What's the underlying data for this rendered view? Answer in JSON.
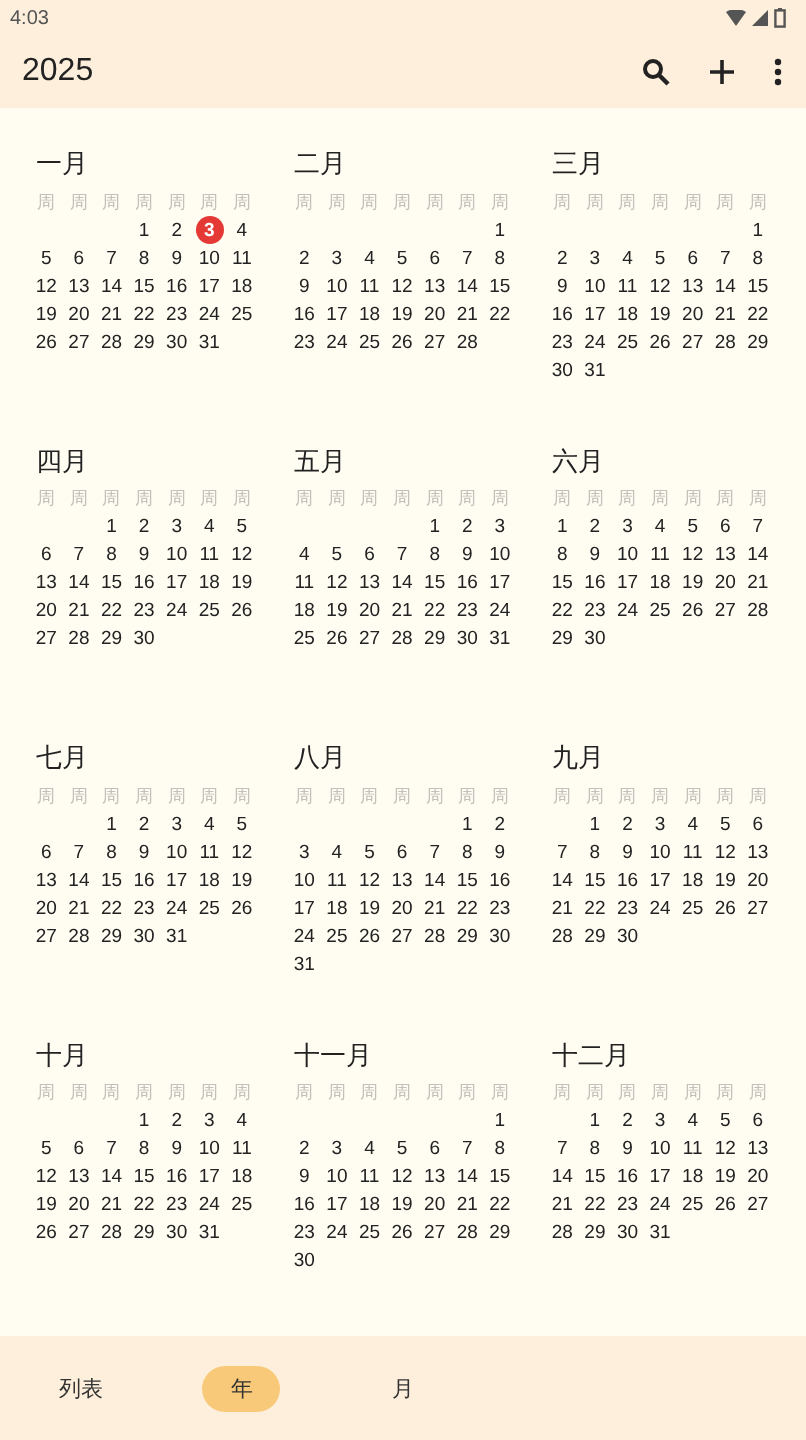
{
  "status_bar": {
    "time": "4:03"
  },
  "app_bar": {
    "title": "2025"
  },
  "months": [
    {
      "name": "一月",
      "weekdays": [
        "周",
        "周",
        "周",
        "周",
        "周",
        "周",
        "周"
      ],
      "weeks": [
        [
          {
            "day": "1",
            "selected": false
          },
          {
            "day": "2",
            "selected": false
          },
          {
            "day": "3",
            "selected": true
          },
          {
            "day": "4",
            "selected": false
          }
        ],
        [
          {
            "day": "5",
            "selected": false
          },
          {
            "day": "6",
            "selected": false
          },
          {
            "day": "7",
            "selected": false
          },
          {
            "day": "8",
            "selected": false
          },
          {
            "day": "9",
            "selected": false
          },
          {
            "day": "10",
            "selected": false
          },
          {
            "day": "11",
            "selected": false
          }
        ],
        [
          {
            "day": "12",
            "selected": false
          },
          {
            "day": "13",
            "selected": false
          },
          {
            "day": "14",
            "selected": false
          },
          {
            "day": "15",
            "selected": false
          },
          {
            "day": "16",
            "selected": false
          },
          {
            "day": "17",
            "selected": false
          },
          {
            "day": "18",
            "selected": false
          }
        ],
        [
          {
            "day": "19",
            "selected": false
          },
          {
            "day": "20",
            "selected": false
          },
          {
            "day": "21",
            "selected": false
          },
          {
            "day": "22",
            "selected": false
          },
          {
            "day": "23",
            "selected": false
          },
          {
            "day": "24",
            "selected": false
          },
          {
            "day": "25",
            "selected": false
          }
        ],
        [
          {
            "day": "26",
            "selected": false
          },
          {
            "day": "27",
            "selected": false
          },
          {
            "day": "28",
            "selected": false
          },
          {
            "day": "29",
            "selected": false
          },
          {
            "day": "30",
            "selected": false
          },
          {
            "day": "31",
            "selected": false
          }
        ]
      ]
    },
    {
      "name": "二月",
      "weekdays": [
        "周",
        "周",
        "周",
        "周",
        "周",
        "周",
        "周"
      ],
      "weeks": [
        [
          {
            "day": "1",
            "selected": false
          }
        ],
        [
          {
            "day": "2",
            "selected": false
          },
          {
            "day": "3",
            "selected": false
          },
          {
            "day": "4",
            "selected": false
          },
          {
            "day": "5",
            "selected": false
          },
          {
            "day": "6",
            "selected": false
          },
          {
            "day": "7",
            "selected": false
          },
          {
            "day": "8",
            "selected": false
          }
        ],
        [
          {
            "day": "9",
            "selected": false
          },
          {
            "day": "10",
            "selected": false
          },
          {
            "day": "11",
            "selected": false
          },
          {
            "day": "12",
            "selected": false
          },
          {
            "day": "13",
            "selected": false
          },
          {
            "day": "14",
            "selected": false
          },
          {
            "day": "15",
            "selected": false
          }
        ],
        [
          {
            "day": "16",
            "selected": false
          },
          {
            "day": "17",
            "selected": false
          },
          {
            "day": "18",
            "selected": false
          },
          {
            "day": "19",
            "selected": false
          },
          {
            "day": "20",
            "selected": false
          },
          {
            "day": "21",
            "selected": false
          },
          {
            "day": "22",
            "selected": false
          }
        ],
        [
          {
            "day": "23",
            "selected": false
          },
          {
            "day": "24",
            "selected": false
          },
          {
            "day": "25",
            "selected": false
          },
          {
            "day": "26",
            "selected": false
          },
          {
            "day": "27",
            "selected": false
          },
          {
            "day": "28",
            "selected": false
          }
        ]
      ]
    },
    {
      "name": "三月",
      "weekdays": [
        "周",
        "周",
        "周",
        "周",
        "周",
        "周",
        "周"
      ],
      "weeks": [
        [
          {
            "day": "1",
            "selected": false
          }
        ],
        [
          {
            "day": "2",
            "selected": false
          },
          {
            "day": "3",
            "selected": false
          },
          {
            "day": "4",
            "selected": false
          },
          {
            "day": "5",
            "selected": false
          },
          {
            "day": "6",
            "selected": false
          },
          {
            "day": "7",
            "selected": false
          },
          {
            "day": "8",
            "selected": false
          }
        ],
        [
          {
            "day": "9",
            "selected": false
          },
          {
            "day": "10",
            "selected": false
          },
          {
            "day": "11",
            "selected": false
          },
          {
            "day": "12",
            "selected": false
          },
          {
            "day": "13",
            "selected": false
          },
          {
            "day": "14",
            "selected": false
          },
          {
            "day": "15",
            "selected": false
          }
        ],
        [
          {
            "day": "16",
            "selected": false
          },
          {
            "day": "17",
            "selected": false
          },
          {
            "day": "18",
            "selected": false
          },
          {
            "day": "19",
            "selected": false
          },
          {
            "day": "20",
            "selected": false
          },
          {
            "day": "21",
            "selected": false
          },
          {
            "day": "22",
            "selected": false
          }
        ],
        [
          {
            "day": "23",
            "selected": false
          },
          {
            "day": "24",
            "selected": false
          },
          {
            "day": "25",
            "selected": false
          },
          {
            "day": "26",
            "selected": false
          },
          {
            "day": "27",
            "selected": false
          },
          {
            "day": "28",
            "selected": false
          },
          {
            "day": "29",
            "selected": false
          }
        ],
        [
          {
            "day": "30",
            "selected": false
          },
          {
            "day": "31",
            "selected": false
          }
        ]
      ]
    },
    {
      "name": "四月",
      "weekdays": [
        "周",
        "周",
        "周",
        "周",
        "周",
        "周",
        "周"
      ],
      "weeks": [
        [
          {
            "day": "1",
            "selected": false
          },
          {
            "day": "2",
            "selected": false
          },
          {
            "day": "3",
            "selected": false
          },
          {
            "day": "4",
            "selected": false
          },
          {
            "day": "5",
            "selected": false
          }
        ],
        [
          {
            "day": "6",
            "selected": false
          },
          {
            "day": "7",
            "selected": false
          },
          {
            "day": "8",
            "selected": false
          },
          {
            "day": "9",
            "selected": false
          },
          {
            "day": "10",
            "selected": false
          },
          {
            "day": "11",
            "selected": false
          },
          {
            "day": "12",
            "selected": false
          }
        ],
        [
          {
            "day": "13",
            "selected": false
          },
          {
            "day": "14",
            "selected": false
          },
          {
            "day": "15",
            "selected": false
          },
          {
            "day": "16",
            "selected": false
          },
          {
            "day": "17",
            "selected": false
          },
          {
            "day": "18",
            "selected": false
          },
          {
            "day": "19",
            "selected": false
          }
        ],
        [
          {
            "day": "20",
            "selected": false
          },
          {
            "day": "21",
            "selected": false
          },
          {
            "day": "22",
            "selected": false
          },
          {
            "day": "23",
            "selected": false
          },
          {
            "day": "24",
            "selected": false
          },
          {
            "day": "25",
            "selected": false
          },
          {
            "day": "26",
            "selected": false
          }
        ],
        [
          {
            "day": "27",
            "selected": false
          },
          {
            "day": "28",
            "selected": false
          },
          {
            "day": "29",
            "selected": false
          },
          {
            "day": "30",
            "selected": false
          }
        ]
      ]
    },
    {
      "name": "五月",
      "weekdays": [
        "周",
        "周",
        "周",
        "周",
        "周",
        "周",
        "周"
      ],
      "weeks": [
        [
          {
            "day": "1",
            "selected": false
          },
          {
            "day": "2",
            "selected": false
          },
          {
            "day": "3",
            "selected": false
          }
        ],
        [
          {
            "day": "4",
            "selected": false
          },
          {
            "day": "5",
            "selected": false
          },
          {
            "day": "6",
            "selected": false
          },
          {
            "day": "7",
            "selected": false
          },
          {
            "day": "8",
            "selected": false
          },
          {
            "day": "9",
            "selected": false
          },
          {
            "day": "10",
            "selected": false
          }
        ],
        [
          {
            "day": "11",
            "selected": false
          },
          {
            "day": "12",
            "selected": false
          },
          {
            "day": "13",
            "selected": false
          },
          {
            "day": "14",
            "selected": false
          },
          {
            "day": "15",
            "selected": false
          },
          {
            "day": "16",
            "selected": false
          },
          {
            "day": "17",
            "selected": false
          }
        ],
        [
          {
            "day": "18",
            "selected": false
          },
          {
            "day": "19",
            "selected": false
          },
          {
            "day": "20",
            "selected": false
          },
          {
            "day": "21",
            "selected": false
          },
          {
            "day": "22",
            "selected": false
          },
          {
            "day": "23",
            "selected": false
          },
          {
            "day": "24",
            "selected": false
          }
        ],
        [
          {
            "day": "25",
            "selected": false
          },
          {
            "day": "26",
            "selected": false
          },
          {
            "day": "27",
            "selected": false
          },
          {
            "day": "28",
            "selected": false
          },
          {
            "day": "29",
            "selected": false
          },
          {
            "day": "30",
            "selected": false
          },
          {
            "day": "31",
            "selected": false
          }
        ]
      ]
    },
    {
      "name": "六月",
      "weekdays": [
        "周",
        "周",
        "周",
        "周",
        "周",
        "周",
        "周"
      ],
      "weeks": [
        [
          {
            "day": "1",
            "selected": false
          },
          {
            "day": "2",
            "selected": false
          },
          {
            "day": "3",
            "selected": false
          },
          {
            "day": "4",
            "selected": false
          },
          {
            "day": "5",
            "selected": false
          },
          {
            "day": "6",
            "selected": false
          },
          {
            "day": "7",
            "selected": false
          }
        ],
        [
          {
            "day": "8",
            "selected": false
          },
          {
            "day": "9",
            "selected": false
          },
          {
            "day": "10",
            "selected": false
          },
          {
            "day": "11",
            "selected": false
          },
          {
            "day": "12",
            "selected": false
          },
          {
            "day": "13",
            "selected": false
          },
          {
            "day": "14",
            "selected": false
          }
        ],
        [
          {
            "day": "15",
            "selected": false
          },
          {
            "day": "16",
            "selected": false
          },
          {
            "day": "17",
            "selected": false
          },
          {
            "day": "18",
            "selected": false
          },
          {
            "day": "19",
            "selected": false
          },
          {
            "day": "20",
            "selected": false
          },
          {
            "day": "21",
            "selected": false
          }
        ],
        [
          {
            "day": "22",
            "selected": false
          },
          {
            "day": "23",
            "selected": false
          },
          {
            "day": "24",
            "selected": false
          },
          {
            "day": "25",
            "selected": false
          },
          {
            "day": "26",
            "selected": false
          },
          {
            "day": "27",
            "selected": false
          },
          {
            "day": "28",
            "selected": false
          }
        ],
        [
          {
            "day": "29",
            "selected": false
          },
          {
            "day": "30",
            "selected": false
          }
        ]
      ]
    },
    {
      "name": "七月",
      "weekdays": [
        "周",
        "周",
        "周",
        "周",
        "周",
        "周",
        "周"
      ],
      "weeks": [
        [
          {
            "day": "1",
            "selected": false
          },
          {
            "day": "2",
            "selected": false
          },
          {
            "day": "3",
            "selected": false
          },
          {
            "day": "4",
            "selected": false
          },
          {
            "day": "5",
            "selected": false
          }
        ],
        [
          {
            "day": "6",
            "selected": false
          },
          {
            "day": "7",
            "selected": false
          },
          {
            "day": "8",
            "selected": false
          },
          {
            "day": "9",
            "selected": false
          },
          {
            "day": "10",
            "selected": false
          },
          {
            "day": "11",
            "selected": false
          },
          {
            "day": "12",
            "selected": false
          }
        ],
        [
          {
            "day": "13",
            "selected": false
          },
          {
            "day": "14",
            "selected": false
          },
          {
            "day": "15",
            "selected": false
          },
          {
            "day": "16",
            "selected": false
          },
          {
            "day": "17",
            "selected": false
          },
          {
            "day": "18",
            "selected": false
          },
          {
            "day": "19",
            "selected": false
          }
        ],
        [
          {
            "day": "20",
            "selected": false
          },
          {
            "day": "21",
            "selected": false
          },
          {
            "day": "22",
            "selected": false
          },
          {
            "day": "23",
            "selected": false
          },
          {
            "day": "24",
            "selected": false
          },
          {
            "day": "25",
            "selected": false
          },
          {
            "day": "26",
            "selected": false
          }
        ],
        [
          {
            "day": "27",
            "selected": false
          },
          {
            "day": "28",
            "selected": false
          },
          {
            "day": "29",
            "selected": false
          },
          {
            "day": "30",
            "selected": false
          },
          {
            "day": "31",
            "selected": false
          }
        ]
      ]
    },
    {
      "name": "八月",
      "weekdays": [
        "周",
        "周",
        "周",
        "周",
        "周",
        "周",
        "周"
      ],
      "weeks": [
        [
          {
            "day": "1",
            "selected": false
          },
          {
            "day": "2",
            "selected": false
          }
        ],
        [
          {
            "day": "3",
            "selected": false
          },
          {
            "day": "4",
            "selected": false
          },
          {
            "day": "5",
            "selected": false
          },
          {
            "day": "6",
            "selected": false
          },
          {
            "day": "7",
            "selected": false
          },
          {
            "day": "8",
            "selected": false
          },
          {
            "day": "9",
            "selected": false
          }
        ],
        [
          {
            "day": "10",
            "selected": false
          },
          {
            "day": "11",
            "selected": false
          },
          {
            "day": "12",
            "selected": false
          },
          {
            "day": "13",
            "selected": false
          },
          {
            "day": "14",
            "selected": false
          },
          {
            "day": "15",
            "selected": false
          },
          {
            "day": "16",
            "selected": false
          }
        ],
        [
          {
            "day": "17",
            "selected": false
          },
          {
            "day": "18",
            "selected": false
          },
          {
            "day": "19",
            "selected": false
          },
          {
            "day": "20",
            "selected": false
          },
          {
            "day": "21",
            "selected": false
          },
          {
            "day": "22",
            "selected": false
          },
          {
            "day": "23",
            "selected": false
          }
        ],
        [
          {
            "day": "24",
            "selected": false
          },
          {
            "day": "25",
            "selected": false
          },
          {
            "day": "26",
            "selected": false
          },
          {
            "day": "27",
            "selected": false
          },
          {
            "day": "28",
            "selected": false
          },
          {
            "day": "29",
            "selected": false
          },
          {
            "day": "30",
            "selected": false
          }
        ],
        [
          {
            "day": "31",
            "selected": false
          }
        ]
      ]
    },
    {
      "name": "九月",
      "weekdays": [
        "周",
        "周",
        "周",
        "周",
        "周",
        "周",
        "周"
      ],
      "weeks": [
        [
          {
            "day": "1",
            "selected": false
          },
          {
            "day": "2",
            "selected": false
          },
          {
            "day": "3",
            "selected": false
          },
          {
            "day": "4",
            "selected": false
          },
          {
            "day": "5",
            "selected": false
          },
          {
            "day": "6",
            "selected": false
          }
        ],
        [
          {
            "day": "7",
            "selected": false
          },
          {
            "day": "8",
            "selected": false
          },
          {
            "day": "9",
            "selected": false
          },
          {
            "day": "10",
            "selected": false
          },
          {
            "day": "11",
            "selected": false
          },
          {
            "day": "12",
            "selected": false
          },
          {
            "day": "13",
            "selected": false
          }
        ],
        [
          {
            "day": "14",
            "selected": false
          },
          {
            "day": "15",
            "selected": false
          },
          {
            "day": "16",
            "selected": false
          },
          {
            "day": "17",
            "selected": false
          },
          {
            "day": "18",
            "selected": false
          },
          {
            "day": "19",
            "selected": false
          },
          {
            "day": "20",
            "selected": false
          }
        ],
        [
          {
            "day": "21",
            "selected": false
          },
          {
            "day": "22",
            "selected": false
          },
          {
            "day": "23",
            "selected": false
          },
          {
            "day": "24",
            "selected": false
          },
          {
            "day": "25",
            "selected": false
          },
          {
            "day": "26",
            "selected": false
          },
          {
            "day": "27",
            "selected": false
          }
        ],
        [
          {
            "day": "28",
            "selected": false
          },
          {
            "day": "29",
            "selected": false
          },
          {
            "day": "30",
            "selected": false
          }
        ]
      ]
    },
    {
      "name": "十月",
      "weekdays": [
        "周",
        "周",
        "周",
        "周",
        "周",
        "周",
        "周"
      ],
      "weeks": [
        [
          {
            "day": "1",
            "selected": false
          },
          {
            "day": "2",
            "selected": false
          },
          {
            "day": "3",
            "selected": false
          },
          {
            "day": "4",
            "selected": false
          }
        ],
        [
          {
            "day": "5",
            "selected": false
          },
          {
            "day": "6",
            "selected": false
          },
          {
            "day": "7",
            "selected": false
          },
          {
            "day": "8",
            "selected": false
          },
          {
            "day": "9",
            "selected": false
          },
          {
            "day": "10",
            "selected": false
          },
          {
            "day": "11",
            "selected": false
          }
        ],
        [
          {
            "day": "12",
            "selected": false
          },
          {
            "day": "13",
            "selected": false
          },
          {
            "day": "14",
            "selected": false
          },
          {
            "day": "15",
            "selected": false
          },
          {
            "day": "16",
            "selected": false
          },
          {
            "day": "17",
            "selected": false
          },
          {
            "day": "18",
            "selected": false
          }
        ],
        [
          {
            "day": "19",
            "selected": false
          },
          {
            "day": "20",
            "selected": false
          },
          {
            "day": "21",
            "selected": false
          },
          {
            "day": "22",
            "selected": false
          },
          {
            "day": "23",
            "selected": false
          },
          {
            "day": "24",
            "selected": false
          },
          {
            "day": "25",
            "selected": false
          }
        ],
        [
          {
            "day": "26",
            "selected": false
          },
          {
            "day": "27",
            "selected": false
          },
          {
            "day": "28",
            "selected": false
          },
          {
            "day": "29",
            "selected": false
          },
          {
            "day": "30",
            "selected": false
          },
          {
            "day": "31",
            "selected": false
          }
        ]
      ]
    },
    {
      "name": "十一月",
      "weekdays": [
        "周",
        "周",
        "周",
        "周",
        "周",
        "周",
        "周"
      ],
      "weeks": [
        [
          {
            "day": "1",
            "selected": false
          }
        ],
        [
          {
            "day": "2",
            "selected": false
          },
          {
            "day": "3",
            "selected": false
          },
          {
            "day": "4",
            "selected": false
          },
          {
            "day": "5",
            "selected": false
          },
          {
            "day": "6",
            "selected": false
          },
          {
            "day": "7",
            "selected": false
          },
          {
            "day": "8",
            "selected": false
          }
        ],
        [
          {
            "day": "9",
            "selected": false
          },
          {
            "day": "10",
            "selected": false
          },
          {
            "day": "11",
            "selected": false
          },
          {
            "day": "12",
            "selected": false
          },
          {
            "day": "13",
            "selected": false
          },
          {
            "day": "14",
            "selected": false
          },
          {
            "day": "15",
            "selected": false
          }
        ],
        [
          {
            "day": "16",
            "selected": false
          },
          {
            "day": "17",
            "selected": false
          },
          {
            "day": "18",
            "selected": false
          },
          {
            "day": "19",
            "selected": false
          },
          {
            "day": "20",
            "selected": false
          },
          {
            "day": "21",
            "selected": false
          },
          {
            "day": "22",
            "selected": false
          }
        ],
        [
          {
            "day": "23",
            "selected": false
          },
          {
            "day": "24",
            "selected": false
          },
          {
            "day": "25",
            "selected": false
          },
          {
            "day": "26",
            "selected": false
          },
          {
            "day": "27",
            "selected": false
          },
          {
            "day": "28",
            "selected": false
          },
          {
            "day": "29",
            "selected": false
          }
        ],
        [
          {
            "day": "30",
            "selected": false
          }
        ]
      ]
    },
    {
      "name": "十二月",
      "weekdays": [
        "周",
        "周",
        "周",
        "周",
        "周",
        "周",
        "周"
      ],
      "weeks": [
        [
          {
            "day": "1",
            "selected": false
          },
          {
            "day": "2",
            "selected": false
          },
          {
            "day": "3",
            "selected": false
          },
          {
            "day": "4",
            "selected": false
          },
          {
            "day": "5",
            "selected": false
          },
          {
            "day": "6",
            "selected": false
          }
        ],
        [
          {
            "day": "7",
            "selected": false
          },
          {
            "day": "8",
            "selected": false
          },
          {
            "day": "9",
            "selected": false
          },
          {
            "day": "10",
            "selected": false
          },
          {
            "day": "11",
            "selected": false
          },
          {
            "day": "12",
            "selected": false
          },
          {
            "day": "13",
            "selected": false
          }
        ],
        [
          {
            "day": "14",
            "selected": false
          },
          {
            "day": "15",
            "selected": false
          },
          {
            "day": "16",
            "selected": false
          },
          {
            "day": "17",
            "selected": false
          },
          {
            "day": "18",
            "selected": false
          },
          {
            "day": "19",
            "selected": false
          },
          {
            "day": "20",
            "selected": false
          }
        ],
        [
          {
            "day": "21",
            "selected": false
          },
          {
            "day": "22",
            "selected": false
          },
          {
            "day": "23",
            "selected": false
          },
          {
            "day": "24",
            "selected": false
          },
          {
            "day": "25",
            "selected": false
          },
          {
            "day": "26",
            "selected": false
          },
          {
            "day": "27",
            "selected": false
          }
        ],
        [
          {
            "day": "28",
            "selected": false
          },
          {
            "day": "29",
            "selected": false
          },
          {
            "day": "30",
            "selected": false
          },
          {
            "day": "31",
            "selected": false
          }
        ]
      ]
    }
  ],
  "bottom_nav": [
    {
      "label": "列表",
      "selected": false
    },
    {
      "label": "年",
      "selected": true
    },
    {
      "label": "月",
      "selected": false
    }
  ]
}
